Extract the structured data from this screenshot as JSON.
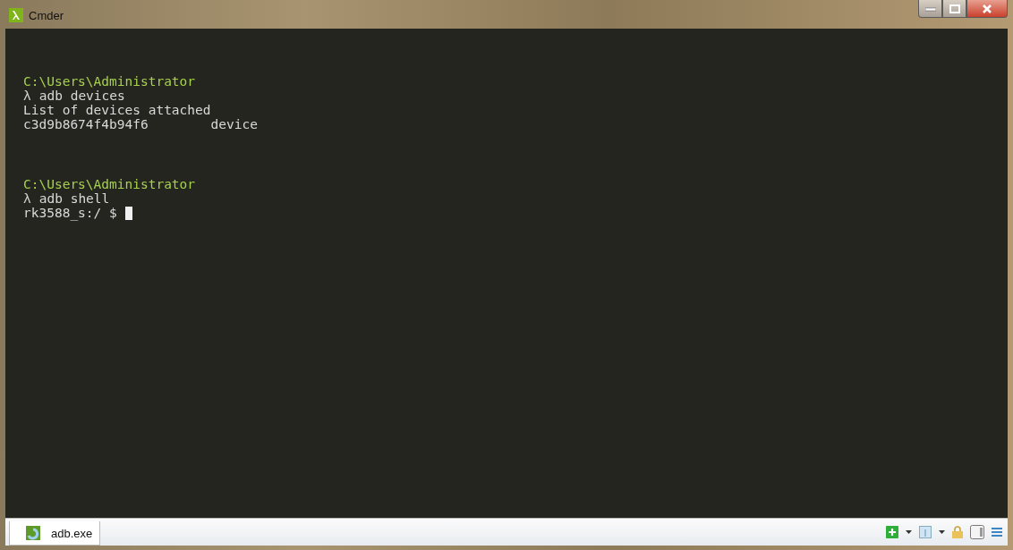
{
  "window": {
    "title": "Cmder"
  },
  "terminal": {
    "blocks": [
      {
        "lines": [
          {
            "kind": "path",
            "text": "C:\\Users\\Administrator"
          },
          {
            "kind": "command",
            "symbol": "λ",
            "text": "adb devices"
          },
          {
            "kind": "output",
            "text": "List of devices attached"
          },
          {
            "kind": "output",
            "text": "c3d9b8674f4b94f6\tdevice"
          }
        ]
      },
      {
        "lines": [
          {
            "kind": "path",
            "text": "C:\\Users\\Administrator"
          },
          {
            "kind": "command",
            "symbol": "λ",
            "text": "adb shell"
          },
          {
            "kind": "prompt",
            "text": "rk3588_s:/ $"
          }
        ]
      }
    ]
  },
  "tabs": [
    {
      "label": "adb.exe",
      "selected": true
    }
  ]
}
